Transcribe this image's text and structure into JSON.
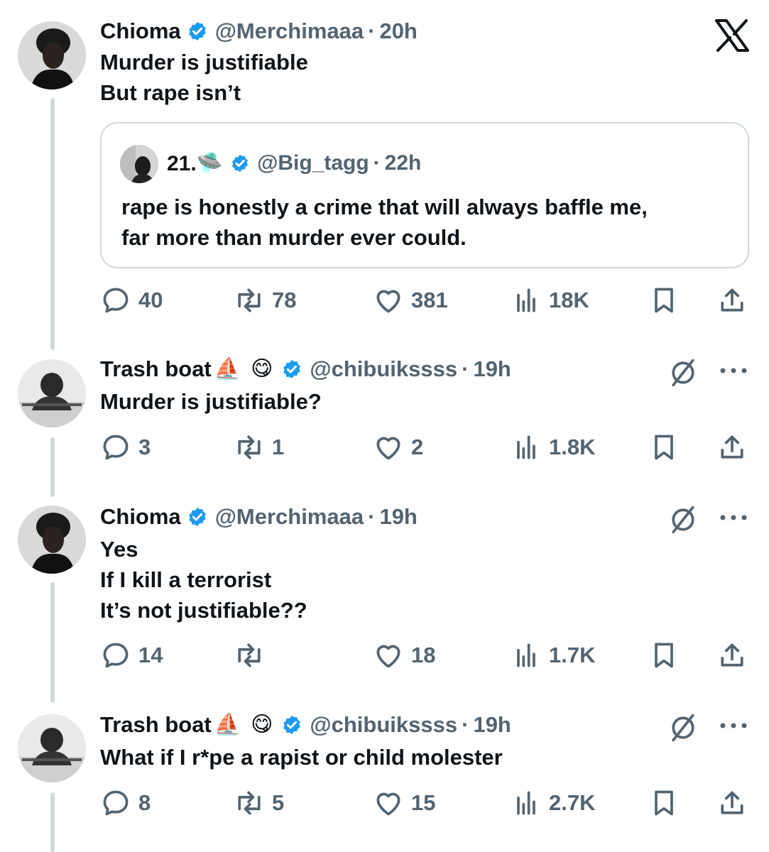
{
  "app": {
    "logo_icon": "x-logo-icon"
  },
  "colors": {
    "verified": "#1d9bf0",
    "muted": "#536471",
    "border": "#cfd9de"
  },
  "tweets": [
    {
      "name": "Chioma",
      "handle": "@Merchimaaa",
      "separator": "·",
      "time": "20h",
      "lines": [
        "Murder is justifiable",
        "But rape isn’t"
      ],
      "quote": {
        "name": "21.🛸",
        "handle": "@Big_tagg",
        "separator": "·",
        "time": "22h",
        "lines": [
          "rape is honestly a crime that will always baffle me,",
          "far more than murder ever could."
        ]
      },
      "replies": "40",
      "reposts": "78",
      "likes": "381",
      "views": "18K"
    },
    {
      "name": "Trash boat",
      "emojis": [
        "⛵",
        "😋"
      ],
      "handle": "@chibuikssss",
      "separator": "·",
      "time": "19h",
      "lines": [
        "Murder is justifiable?"
      ],
      "replies": "3",
      "reposts": "1",
      "likes": "2",
      "views": "1.8K"
    },
    {
      "name": "Chioma",
      "handle": "@Merchimaaa",
      "separator": "·",
      "time": "19h",
      "lines": [
        "Yes",
        "If I kill a terrorist",
        "It’s not justifiable??"
      ],
      "replies": "14",
      "reposts": "",
      "likes": "18",
      "views": "1.7K"
    },
    {
      "name": "Trash boat",
      "emojis": [
        "⛵",
        "😋"
      ],
      "handle": "@chibuikssss",
      "separator": "·",
      "time": "19h",
      "lines": [
        "What if I r*pe a rapist or child molester"
      ],
      "replies": "8",
      "reposts": "5",
      "likes": "15",
      "views": "2.7K"
    }
  ]
}
